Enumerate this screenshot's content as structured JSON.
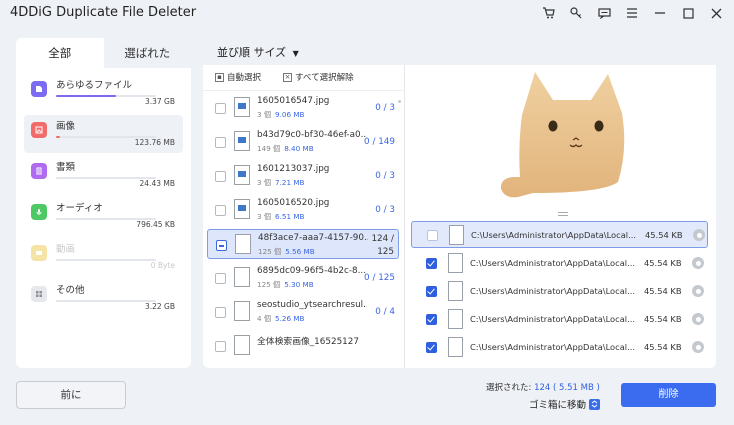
{
  "app": {
    "title": "4DDiG Duplicate File Deleter"
  },
  "left_panel": {
    "tabs": [
      {
        "label": "全部",
        "active": true
      },
      {
        "label": "選ばれた",
        "active": false
      }
    ],
    "categories": [
      {
        "name": "あらゆるファイル",
        "size": "3.37 GB",
        "color": "#7a6bf0",
        "fill": 0.6
      },
      {
        "name": "画像",
        "size": "123.76 MB",
        "color": "#f26b6b",
        "fill": 0.05,
        "selected": true
      },
      {
        "name": "書類",
        "size": "24.43 MB",
        "color": "#b06cf0",
        "fill": 0.0
      },
      {
        "name": "オーディオ",
        "size": "796.45 KB",
        "color": "#4cc864",
        "fill": 0.0
      },
      {
        "name": "動画",
        "size": "0 Byte",
        "color": "#f4d56a",
        "fill": 0.0,
        "disabled": true
      },
      {
        "name": "その他",
        "size": "3.22 GB",
        "color": "#8a8f99",
        "fill": 0.0
      }
    ]
  },
  "main": {
    "sort_label": "並び順 サイズ",
    "toolbar": {
      "auto_select": "自動選択",
      "deselect_all": "すべて選択解除"
    },
    "groups": [
      {
        "name": "1605016547.jpg",
        "count_label": "3 個",
        "size": "9.06 MB",
        "selection": "0 / 3"
      },
      {
        "name": "b43d79c0-bf30-46ef-a0...",
        "count_label": "149 個",
        "size": "8.40 MB",
        "selection": "0 / 149"
      },
      {
        "name": "1601213037.jpg",
        "count_label": "3 個",
        "size": "7.21 MB",
        "selection": "0 / 3"
      },
      {
        "name": "1605016520.jpg",
        "count_label": "3 個",
        "size": "6.51 MB",
        "selection": "0 / 3"
      },
      {
        "name": "48f3ace7-aaa7-4157-90...",
        "count_label": "125 個",
        "size": "5.56 MB",
        "selection_top": "124 /",
        "selection_bottom": "125",
        "selected": true
      },
      {
        "name": "6895dc09-96f5-4b2c-8...",
        "count_label": "125 個",
        "size": "5.30 MB",
        "selection": "0 / 125"
      },
      {
        "name": "seostudio_ytsearchresul...",
        "count_label": "4 個",
        "size": "5.26 MB",
        "selection": "0 / 4"
      },
      {
        "name": "全体検索画像_16525127",
        "count_label": "",
        "size": "",
        "selection": ""
      }
    ],
    "files": [
      {
        "path": "C:\\Users\\Administrator\\AppData\\Local...",
        "size": "45.54 KB",
        "checked": false,
        "selected": true
      },
      {
        "path": "C:\\Users\\Administrator\\AppData\\Local...",
        "size": "45.54 KB",
        "checked": true
      },
      {
        "path": "C:\\Users\\Administrator\\AppData\\Local...",
        "size": "45.54 KB",
        "checked": true
      },
      {
        "path": "C:\\Users\\Administrator\\AppData\\Local...",
        "size": "45.54 KB",
        "checked": true
      },
      {
        "path": "C:\\Users\\Administrator\\AppData\\Local...",
        "size": "45.54 KB",
        "checked": true
      }
    ]
  },
  "footer": {
    "prev_label": "前に",
    "selected_prefix": "選択された:",
    "selected_count": "124",
    "selected_size": "( 5.51 MB )",
    "move_label": "ゴミ箱に移動",
    "delete_label": "削除"
  },
  "colors": {
    "accent": "#3b6cf0",
    "selection_bg": "#dde6fb",
    "cat_bg": "#e8c68f"
  },
  "icons": [
    "cart-icon",
    "key-icon",
    "feedback-icon",
    "menu-icon",
    "minimize-icon",
    "maximize-icon",
    "close-icon",
    "file-icon",
    "image-icon",
    "document-icon",
    "audio-icon",
    "video-icon",
    "other-icon",
    "gear-icon",
    "chevron-down-icon"
  ]
}
